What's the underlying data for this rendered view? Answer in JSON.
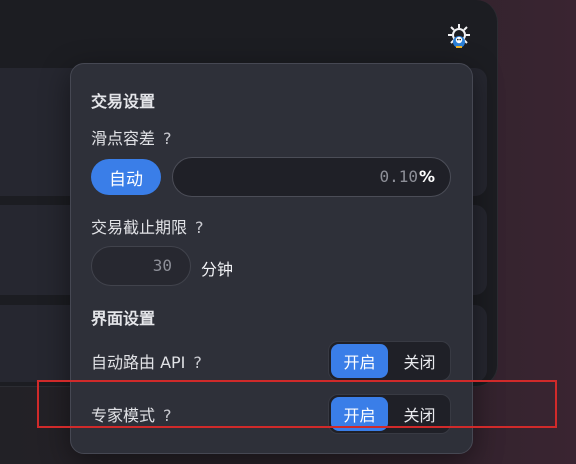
{
  "settings_panel": {
    "trade_settings_title": "交易设置",
    "slippage": {
      "label": "滑点容差",
      "help": "?",
      "auto_button": "自动",
      "value": "0.10",
      "unit": "%"
    },
    "deadline": {
      "label": "交易截止期限",
      "help": "?",
      "value": "30",
      "unit": "分钟"
    },
    "ui_settings_title": "界面设置",
    "auto_router": {
      "label": "自动路由 API",
      "help": "?",
      "on_label": "开启",
      "off_label": "关闭",
      "state": "on"
    },
    "expert_mode": {
      "label": "专家模式",
      "help": "?",
      "on_label": "开启",
      "off_label": "关闭",
      "state": "on"
    }
  },
  "colors": {
    "accent": "#3a7ee8",
    "highlight_box": "#d02a2a",
    "panel_bg": "#2e3039"
  },
  "icons": {
    "settings": "gear-icon"
  }
}
